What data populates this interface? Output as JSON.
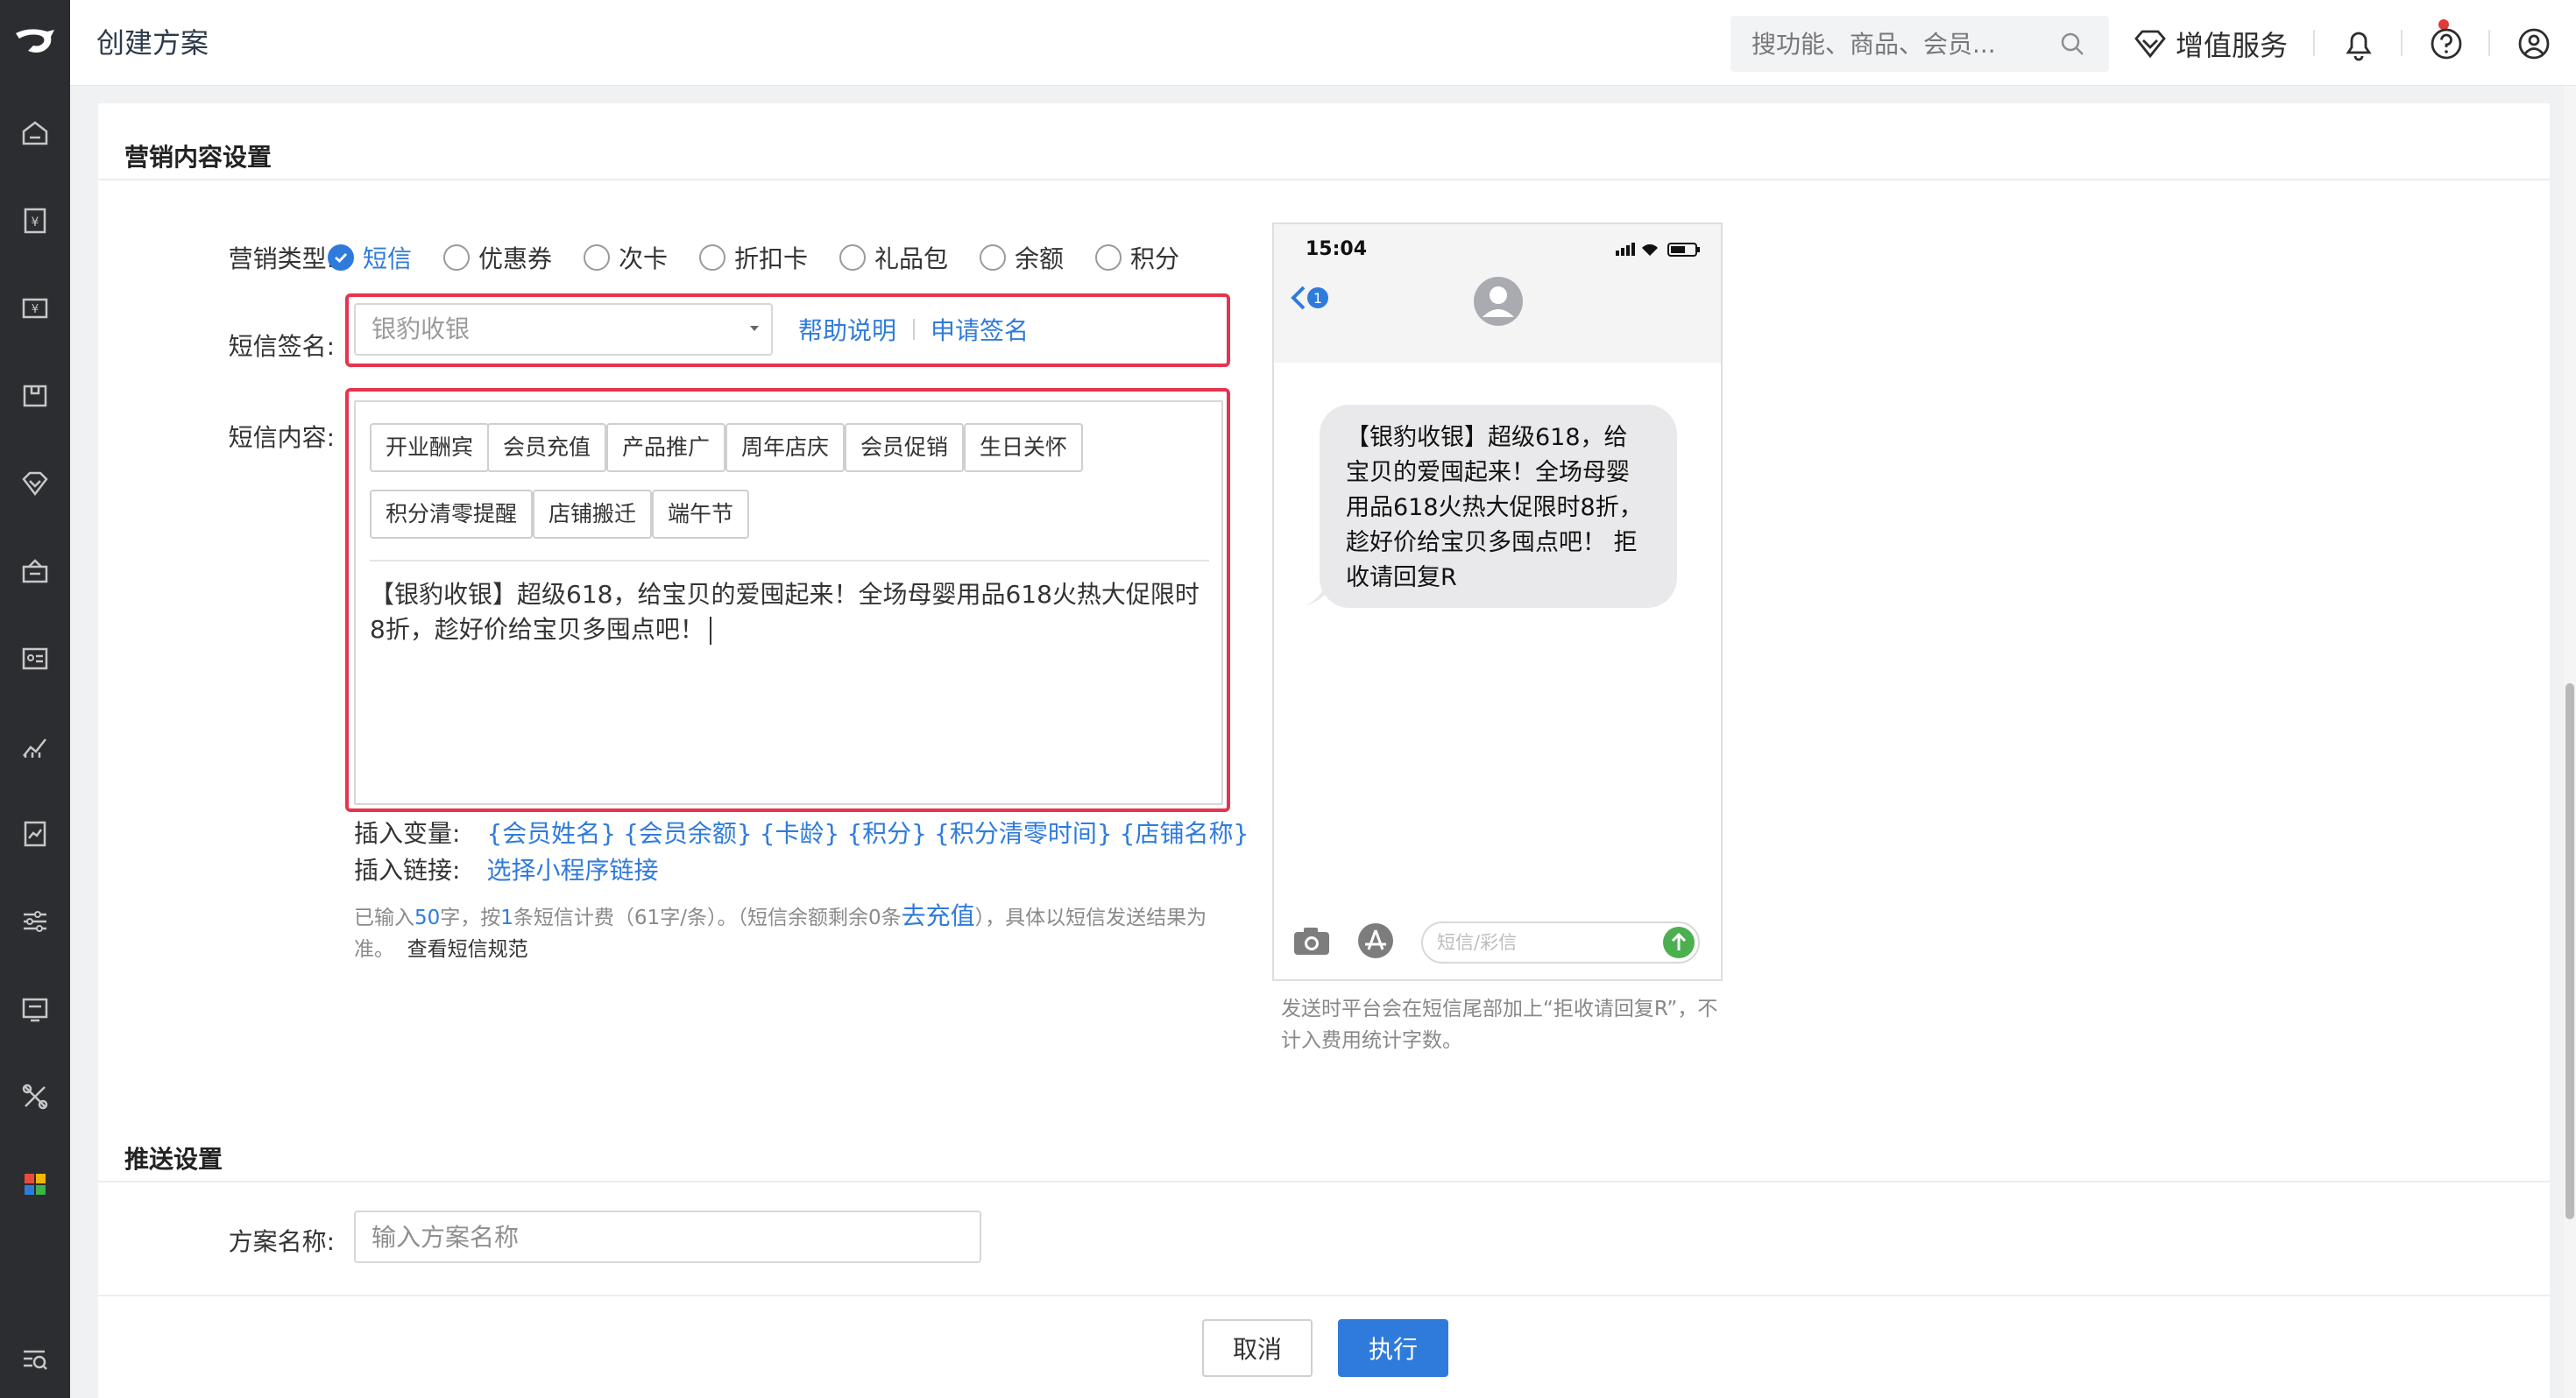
{
  "header": {
    "title": "创建方案",
    "search_placeholder": "搜功能、商品、会员...",
    "value_added_label": "增值服务"
  },
  "sections": {
    "marketing_title": "营销内容设置",
    "push_title": "推送设置"
  },
  "marketing_type": {
    "label": "营销类型:",
    "options": [
      "短信",
      "优惠券",
      "次卡",
      "折扣卡",
      "礼品包",
      "余额",
      "积分"
    ],
    "selected": "短信"
  },
  "sms_signature": {
    "label": "短信签名:",
    "placeholder": "银豹收银",
    "help_link": "帮助说明",
    "apply_link": "申请签名"
  },
  "sms_content": {
    "label": "短信内容:",
    "templates_row1": [
      "开业酬宾",
      "会员充值",
      "产品推广",
      "周年店庆",
      "会员促销",
      "生日关怀"
    ],
    "templates_row2": [
      "积分清零提醒",
      "店铺搬迁",
      "端午节"
    ],
    "text": "【银豹收银】超级618，给宝贝的爱囤起来！全场母婴用品618火热大促限时8折，趁好价给宝贝多囤点吧！"
  },
  "insert_variable": {
    "label": "插入变量:",
    "variables": [
      "{会员姓名}",
      "{会员余额}",
      "{卡龄}",
      "{积分}",
      "{积分清零时间}",
      "{店铺名称}"
    ]
  },
  "insert_link": {
    "label": "插入链接:",
    "link": "选择小程序链接"
  },
  "hint": {
    "p1": "已输入",
    "count": "50",
    "p2": "字，按",
    "sms_count": "1",
    "p3": "条短信计费（61字/条）。（短信余额剩余0条",
    "recharge": "去充值",
    "p4": "），具体以短信发送结果为准。",
    "spec_link": "查看短信规范"
  },
  "phone_preview": {
    "time": "15:04",
    "badge": "1",
    "message": "【银豹收银】超级618，给宝贝的爱囤起来！全场母婴用品618火热大促限时8折，趁好价给宝贝多囤点吧！ 拒收请回复R",
    "input_placeholder": "短信/彩信",
    "note": "发送时平台会在短信尾部加上“拒收请回复R”，不计入费用统计字数。"
  },
  "plan_name": {
    "label": "方案名称:",
    "placeholder": "输入方案名称"
  },
  "footer": {
    "cancel": "取消",
    "execute": "执行"
  },
  "colors": {
    "primary": "#2f7bdc",
    "highlight": "#e6344f",
    "sidebar": "#2b2d31"
  }
}
